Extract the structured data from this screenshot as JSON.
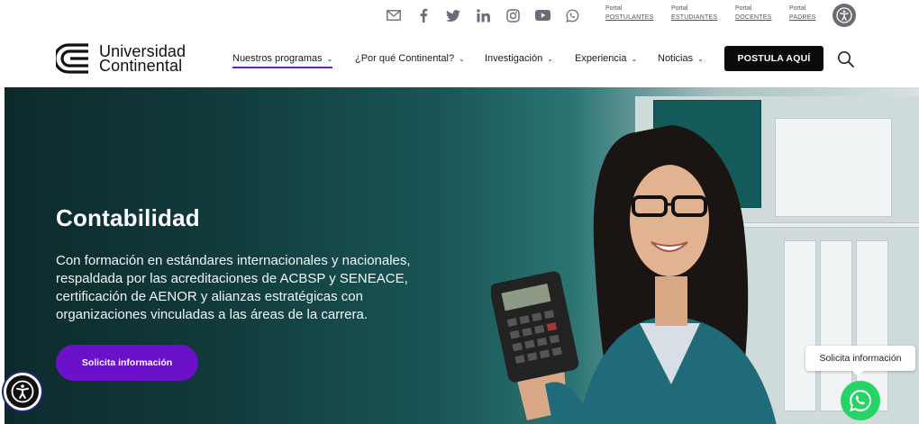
{
  "topbar": {
    "social_icons": [
      "mail-icon",
      "facebook-icon",
      "twitter-icon",
      "linkedin-icon",
      "instagram-icon",
      "youtube-icon",
      "whatsapp-icon"
    ],
    "portals": [
      {
        "label": "Portal",
        "name": "POSTULANTES"
      },
      {
        "label": "Portal",
        "name": "ESTUDIANTES"
      },
      {
        "label": "Portal",
        "name": "DOCENTES"
      },
      {
        "label": "Portal",
        "name": "PADRES"
      }
    ]
  },
  "nav": {
    "logo_line1": "Universidad",
    "logo_line2": "Continental",
    "items": [
      {
        "label": "Nuestros programas"
      },
      {
        "label": "¿Por qué Continental?"
      },
      {
        "label": "Investigación"
      },
      {
        "label": "Experiencia"
      },
      {
        "label": "Noticias"
      }
    ],
    "cta_label": "POSTULA AQUÍ"
  },
  "hero": {
    "title": "Contabilidad",
    "description": "Con formación en estándares internacionales y nacionales, respaldada por las acreditaciones de ACBSP y SENEACE, certificación de AENOR y alianzas estratégicas con organizaciones vinculadas a las áreas de la carrera.",
    "button_label": "Solicita información"
  },
  "floating": {
    "tooltip_label": "Solicita información"
  },
  "colors": {
    "accent": "#6a11c9",
    "nav_underline": "#6a1fd1",
    "whatsapp": "#25d366"
  }
}
